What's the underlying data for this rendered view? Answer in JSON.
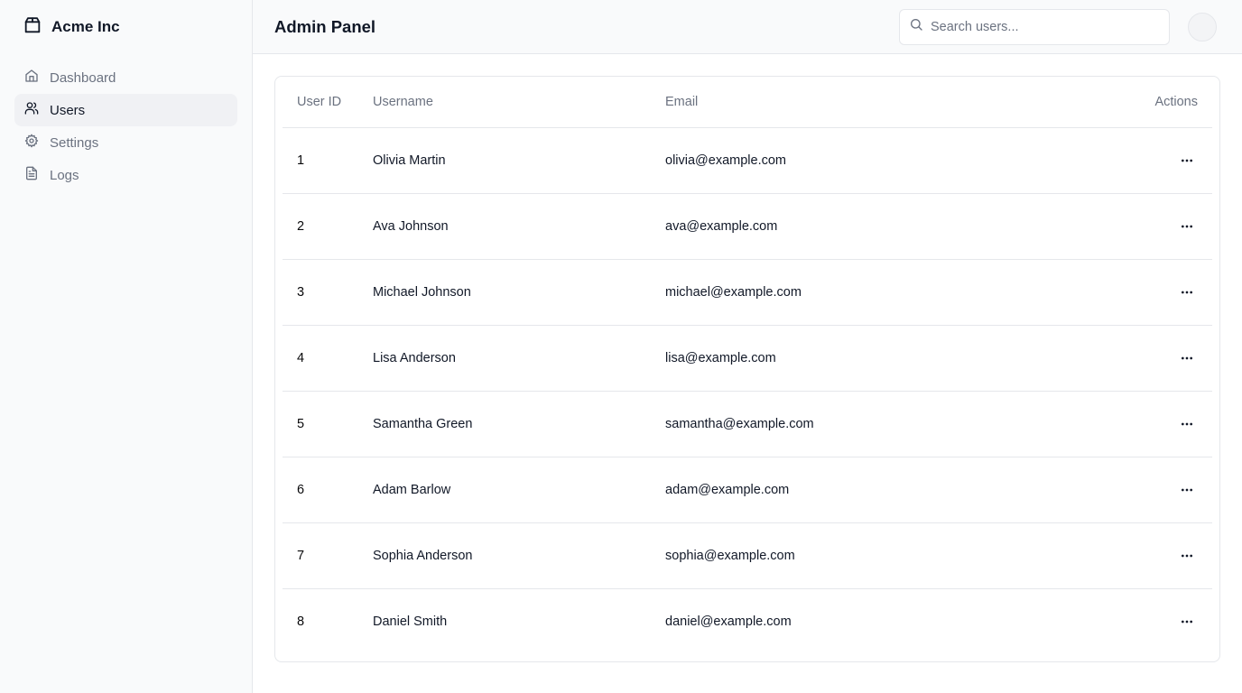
{
  "brand": {
    "name": "Acme Inc",
    "icon": "package-icon"
  },
  "sidebar": {
    "items": [
      {
        "label": "Dashboard",
        "icon": "home-icon",
        "active": false
      },
      {
        "label": "Users",
        "icon": "users-icon",
        "active": true
      },
      {
        "label": "Settings",
        "icon": "gear-icon",
        "active": false
      },
      {
        "label": "Logs",
        "icon": "file-text-icon",
        "active": false
      }
    ]
  },
  "header": {
    "title": "Admin Panel",
    "search_placeholder": "Search users..."
  },
  "table": {
    "headers": {
      "id": "User ID",
      "username": "Username",
      "email": "Email",
      "actions": "Actions"
    },
    "rows": [
      {
        "id": "1",
        "username": "Olivia Martin",
        "email": "olivia@example.com"
      },
      {
        "id": "2",
        "username": "Ava Johnson",
        "email": "ava@example.com"
      },
      {
        "id": "3",
        "username": "Michael Johnson",
        "email": "michael@example.com"
      },
      {
        "id": "4",
        "username": "Lisa Anderson",
        "email": "lisa@example.com"
      },
      {
        "id": "5",
        "username": "Samantha Green",
        "email": "samantha@example.com"
      },
      {
        "id": "6",
        "username": "Adam Barlow",
        "email": "adam@example.com"
      },
      {
        "id": "7",
        "username": "Sophia Anderson",
        "email": "sophia@example.com"
      },
      {
        "id": "8",
        "username": "Daniel Smith",
        "email": "daniel@example.com"
      }
    ]
  },
  "colors": {
    "sidebar_bg": "#f9fafb",
    "active_item_bg": "#f0f1f4",
    "muted_text": "#6b7280",
    "border": "#e5e7eb"
  }
}
